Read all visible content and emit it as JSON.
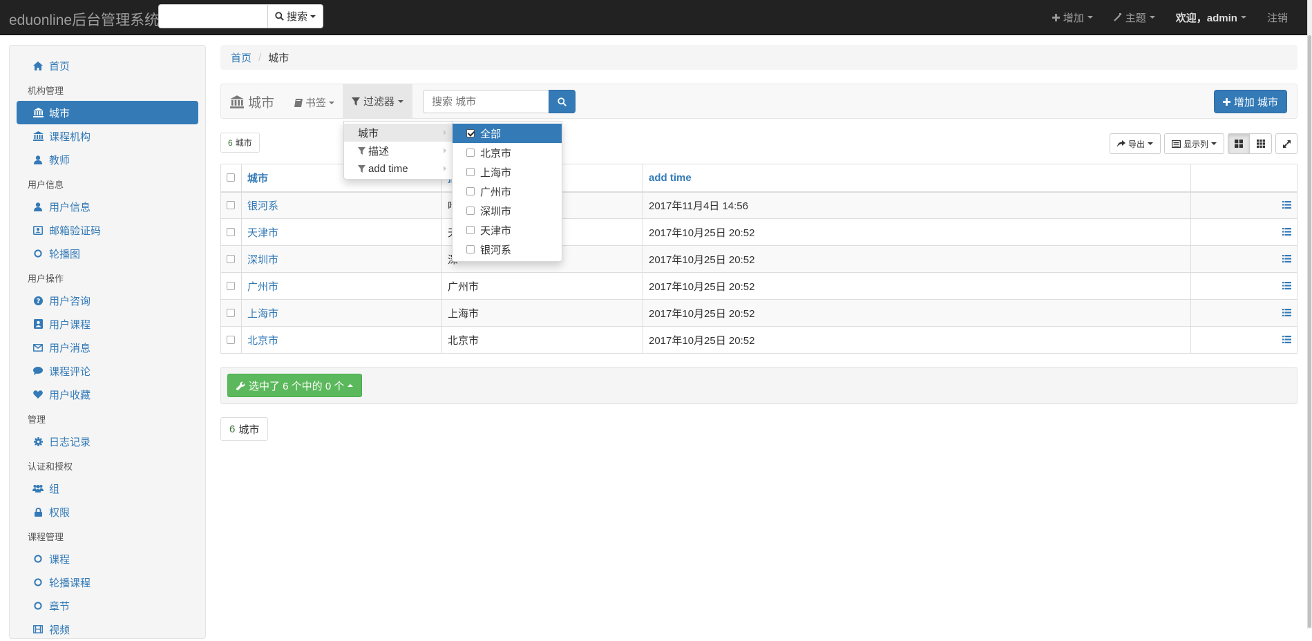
{
  "navbar": {
    "brand": "eduonline后台管理系统",
    "search_placeholder": "",
    "search_button": "搜索",
    "add_label": "增加",
    "theme_label": "主题",
    "welcome_label": "欢迎，admin",
    "logout_label": "注销"
  },
  "sidebar": {
    "home": "首页",
    "group1": "机构管理",
    "city": "城市",
    "course_org": "课程机构",
    "teacher": "教师",
    "group2": "用户信息",
    "user_info": "用户信息",
    "email_code": "邮箱验证码",
    "banner": "轮播图",
    "group3": "用户操作",
    "user_ask": "用户咨询",
    "user_course": "用户课程",
    "user_message": "用户消息",
    "course_comment": "课程评论",
    "user_fav": "用户收藏",
    "group4": "管理",
    "log": "日志记录",
    "group5": "认证和授权",
    "group": "组",
    "permission": "权限",
    "group6": "课程管理",
    "course": "课程",
    "banner_course": "轮播课程",
    "chapter": "章节",
    "video": "视频"
  },
  "breadcrumb": {
    "home": "首页",
    "current": "城市"
  },
  "toolbar": {
    "title": "城市",
    "bookmark": "书签",
    "filter": "过滤器",
    "search_placeholder": "搜索 城市",
    "add_button": "增加 城市"
  },
  "count_badge": {
    "num": "6",
    "label": "城市"
  },
  "tools": {
    "export": "导出",
    "columns": "显示列"
  },
  "filter_menu": {
    "items": [
      "城市",
      "描述",
      "add time"
    ]
  },
  "city_menu": {
    "options": [
      "全部",
      "北京市",
      "上海市",
      "广州市",
      "深圳市",
      "天津市",
      "银河系"
    ]
  },
  "table": {
    "headers": [
      "城市",
      "描述",
      "add time"
    ],
    "rows": [
      {
        "city": "银河系",
        "desc": "哈",
        "time": "2017年11月4日 14:56"
      },
      {
        "city": "天津市",
        "desc": "天",
        "time": "2017年10月25日 20:52"
      },
      {
        "city": "深圳市",
        "desc": "深",
        "time": "2017年10月25日 20:52"
      },
      {
        "city": "广州市",
        "desc": "广州市",
        "time": "2017年10月25日 20:52"
      },
      {
        "city": "上海市",
        "desc": "上海市",
        "time": "2017年10月25日 20:52"
      },
      {
        "city": "北京市",
        "desc": "北京市",
        "time": "2017年10月25日 20:52"
      }
    ]
  },
  "action_bar": {
    "selected_label": "选中了 6 个中的 0 个"
  },
  "pager": {
    "num": "6",
    "label": "城市"
  },
  "colors": {
    "primary": "#337ab7",
    "success": "#5cb85c",
    "navbar": "#222222"
  }
}
